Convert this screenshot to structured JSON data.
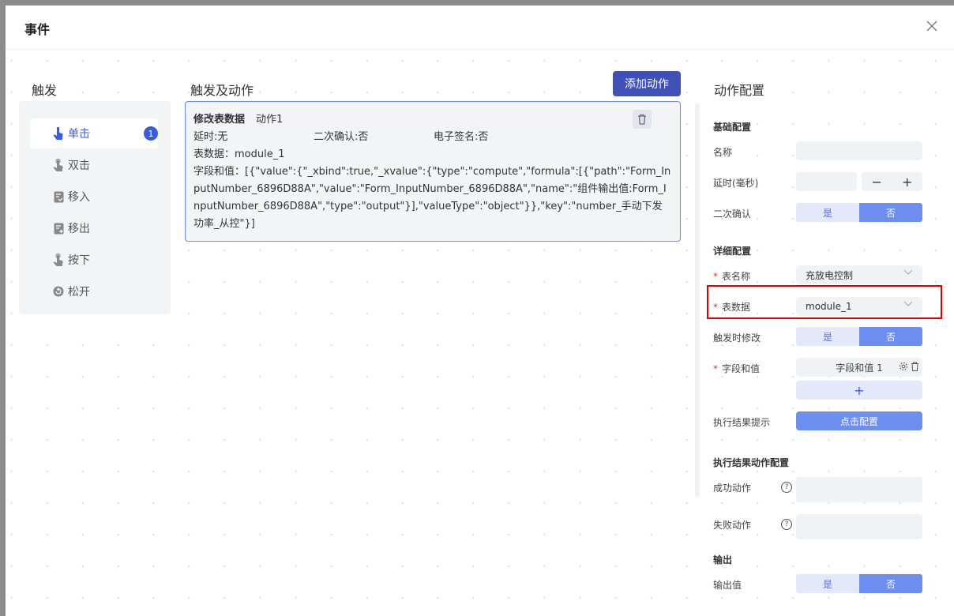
{
  "dialog": {
    "title": "事件"
  },
  "columns": {
    "trigger": "触发",
    "actions": "触发及动作",
    "config": "动作配置"
  },
  "triggers": [
    {
      "label": "单击",
      "icon": "hand-tap-icon",
      "badge": "1",
      "active": true
    },
    {
      "label": "双击",
      "icon": "hand-double-tap-icon"
    },
    {
      "label": "移入",
      "icon": "doc-in-icon"
    },
    {
      "label": "移出",
      "icon": "doc-out-icon"
    },
    {
      "label": "按下",
      "icon": "hand-press-icon"
    },
    {
      "label": "松开",
      "icon": "release-icon"
    }
  ],
  "add_action_label": "添加动作",
  "action_card": {
    "title": "修改表数据",
    "name": "动作1",
    "delay": "延时:无",
    "confirm": "二次确认:否",
    "signature": "电子签名:否",
    "table_data": "表数据：module_1",
    "fields": "字段和值：[{\"value\":{\"_xbind\":true,\"_xvalue\":{\"type\":\"compute\",\"formula\":[{\"path\":\"Form_InputNumber_6896D88A\",\"value\":\"Form_InputNumber_6896D88A\",\"name\":\"组件输出值:Form_InputNumber_6896D88A\",\"type\":\"output\"}],\"valueType\":\"object\"}},\"key\":\"number_手动下发功率_从控\"}]"
  },
  "config": {
    "basic_title": "基础配置",
    "name_label": "名称",
    "delay_label": "延时(毫秒)",
    "confirm_label": "二次确认",
    "yes": "是",
    "no": "否",
    "detail_title": "详细配置",
    "table_name_label": "表名称",
    "table_name_value": "充放电控制",
    "table_data_label": "表数据",
    "table_data_value": "module_1",
    "modify_on_trigger_label": "触发时修改",
    "fields_label": "字段和值",
    "field_tag": "字段和值 1",
    "result_tip_label": "执行结果提示",
    "click_config": "点击配置",
    "result_action_title": "执行结果动作配置",
    "success_label": "成功动作",
    "fail_label": "失败动作",
    "output_title": "输出",
    "output_value_label": "输出值"
  }
}
